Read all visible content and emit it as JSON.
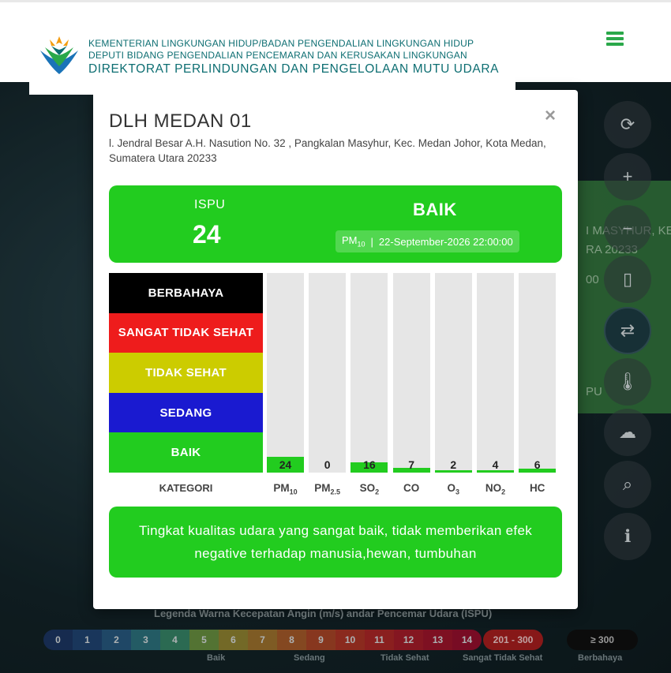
{
  "header": {
    "org_line1": "KEMENTERIAN LINGKUNGAN HIDUP/BADAN PENGENDALIAN LINGKUNGAN HIDUP",
    "org_line2": "DEPUTI BIDANG PENGENDALIAN PENCEMARAN DAN KERUSAKAN LINGKUNGAN",
    "org_line3": "DIREKTORAT PERLINDUNGAN DAN PENGELOLAAN MUTU UDARA"
  },
  "background": {
    "side_text1": "I MASYHUR, KE",
    "side_text2": "RA 20233",
    "side_text3": "00",
    "side_text4": "PU",
    "legend_title": "Legenda Warna Kecepatan Angin (m/s)",
    "legend_title2": "andar Pencemar Udara (ISPU)",
    "wind_scale": [
      "0",
      "1",
      "2",
      "3",
      "4",
      "5",
      "6",
      "7",
      "8",
      "9",
      "10",
      "11",
      "12",
      "13",
      "14"
    ],
    "chip_200": "201 - 300",
    "chip_300": "≥ 300",
    "sub_baik": "Baik",
    "sub_sedang": "Sedang",
    "sub_tidak_sehat": "Tidak Sehat",
    "sub_sangat": "Sangat Tidak Sehat",
    "sub_berbahaya": "Berbahaya"
  },
  "modal": {
    "close": "×",
    "station_name": "DLH MEDAN 01",
    "address": "l. Jendral Besar A.H. Nasution No. 32 , Pangkalan Masyhur, Kec. Medan Johor, Kota Medan, Sumatera Utara 20233",
    "ispu_label": "ISPU",
    "ispu_value": "24",
    "category": "BAIK",
    "pollutant_main": "PM",
    "pollutant_main_sub": "10",
    "separator": "|",
    "timestamp": "22-September-2026 22:00:00",
    "categories": [
      {
        "label": "BERBAHAYA",
        "color": "#000000"
      },
      {
        "label": "SANGAT TIDAK SEHAT",
        "color": "#ee1c1c"
      },
      {
        "label": "TIDAK SEHAT",
        "color": "#cccc00"
      },
      {
        "label": "SEDANG",
        "color": "#1a1ad0"
      },
      {
        "label": "BAIK",
        "color": "#22cc1f"
      }
    ],
    "kategori_label": "KATEGORI",
    "description": "Tingkat kualitas udara yang sangat baik, tidak memberikan efek negative terhadap manusia,hewan, tumbuhan"
  },
  "chart_data": {
    "type": "bar",
    "categories": [
      "PM10",
      "PM2.5",
      "SO2",
      "CO",
      "O3",
      "NO2",
      "HC"
    ],
    "label_base": [
      "PM",
      "PM",
      "SO",
      "CO",
      "O",
      "NO",
      "HC"
    ],
    "label_sub": [
      "10",
      "2.5",
      "2",
      "",
      "3",
      "2",
      ""
    ],
    "values": [
      24,
      0,
      16,
      7,
      2,
      4,
      6
    ],
    "ylim": [
      0,
      300
    ],
    "bar_color": "#22cc1f",
    "track_color": "#e6e6e6"
  }
}
